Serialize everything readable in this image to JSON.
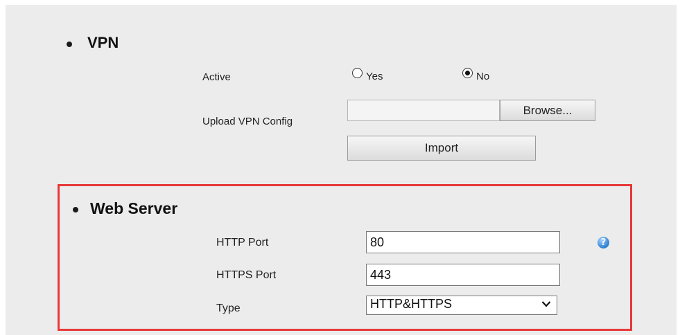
{
  "vpn": {
    "title": "VPN",
    "active_label": "Active",
    "active_options": [
      "Yes",
      "No"
    ],
    "active_selected": "No",
    "upload_label": "Upload VPN Config",
    "file_value": "",
    "browse_label": "Browse...",
    "import_label": "Import"
  },
  "web_server": {
    "title": "Web Server",
    "http_port_label": "HTTP Port",
    "http_port_value": "80",
    "https_port_label": "HTTPS Port",
    "https_port_value": "443",
    "type_label": "Type",
    "type_value": "HTTP&HTTPS",
    "help_icon": "help-question-icon"
  },
  "colors": {
    "panel_background": "#ececec",
    "highlight_border": "#e8383a",
    "help_icon": "#2f7fd0"
  }
}
